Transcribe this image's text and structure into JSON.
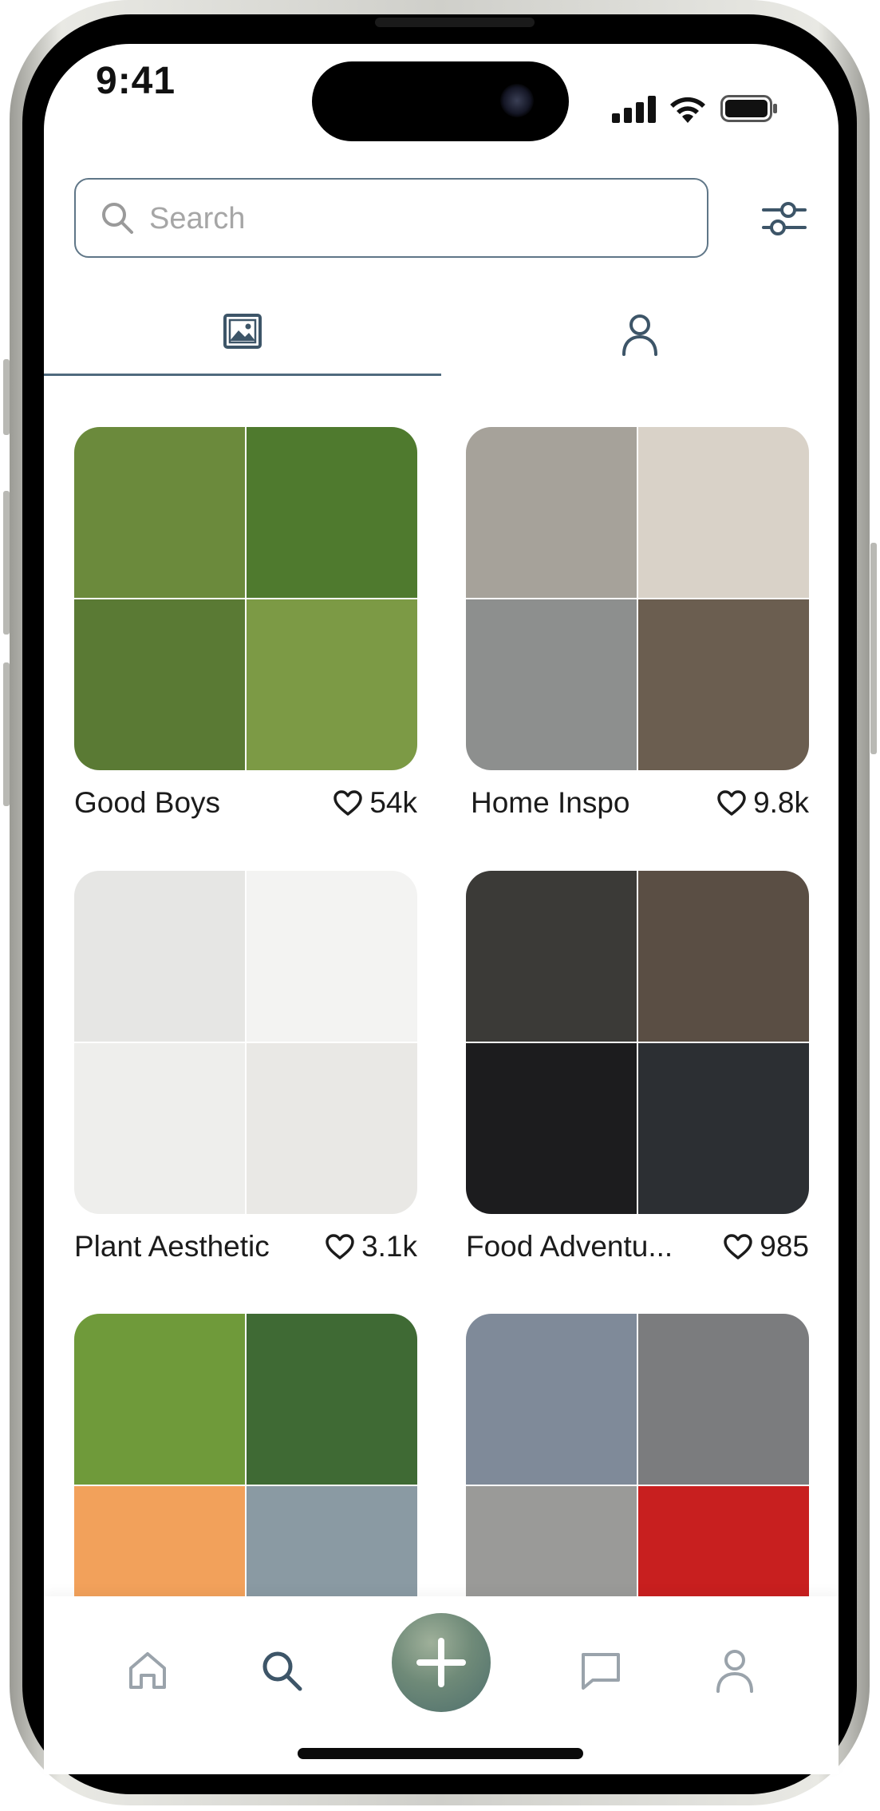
{
  "status_bar": {
    "time": "9:41"
  },
  "search": {
    "placeholder": "Search"
  },
  "tabs": [
    {
      "icon": "image-icon",
      "selected": true
    },
    {
      "icon": "person-icon",
      "selected": false
    }
  ],
  "collections": [
    {
      "title": "Good Boys",
      "likes": "54k",
      "tiles": [
        "#6b8a3c",
        "#4f7a2e",
        "#5a7a34",
        "#7c9a45"
      ]
    },
    {
      "title": "Home Inspo",
      "likes": "9.8k",
      "tiles": [
        "#a6a29a",
        "#d9d2c8",
        "#8d8f8e",
        "#6b5e50"
      ]
    },
    {
      "title": "Plant Aesthetic",
      "likes": "3.1k",
      "tiles": [
        "#e6e6e4",
        "#f3f3f2",
        "#eeeeec",
        "#e9e8e5"
      ]
    },
    {
      "title": "Food Adventu...",
      "likes": "985",
      "tiles": [
        "#3b3a37",
        "#5a4e44",
        "#1c1c1e",
        "#2c2f33"
      ]
    },
    {
      "title": "",
      "likes": "",
      "tiles": [
        "#6f9a3a",
        "#3f6a34",
        "#f2a15b",
        "#8a9aa3"
      ]
    },
    {
      "title": "",
      "likes": "",
      "tiles": [
        "#7f8a99",
        "#7b7c7e",
        "#9a9a98",
        "#c81f1f"
      ]
    }
  ],
  "bottom_nav": [
    {
      "icon": "home-icon",
      "active": false
    },
    {
      "icon": "search-icon",
      "active": true
    },
    {
      "icon": "plus-icon",
      "active": false
    },
    {
      "icon": "chat-icon",
      "active": false
    },
    {
      "icon": "profile-icon",
      "active": false
    }
  ],
  "colors": {
    "accent": "#4f6a7e",
    "inactive_icon": "#9aa3ab",
    "fab_start": "#9fb09a",
    "fab_end": "#4e6f6d"
  }
}
